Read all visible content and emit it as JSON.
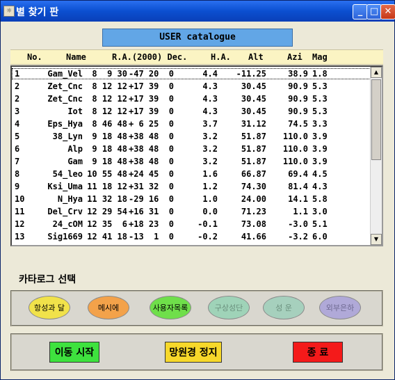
{
  "window": {
    "title": "별 찾기 판",
    "icon": "app-icon",
    "buttons": {
      "minimize": "_",
      "maximize": "□",
      "close": "✕"
    }
  },
  "catalog_title": "USER catalogue",
  "table": {
    "columns": [
      "No.",
      "Name",
      "R.A.(2000) Dec.",
      "H.A.",
      "Alt",
      "Azi",
      "Mag"
    ],
    "rows": [
      {
        "no": "1",
        "name": "Gam_Vel",
        "ra": "8  9 30",
        "dec": "-47 20  0",
        "ha": "4.4",
        "alt": "-11.25",
        "azi": "38.9",
        "mag": "1.8"
      },
      {
        "no": "2",
        "name": "Zet_Cnc",
        "ra": "8 12 12",
        "dec": "+17 39  0",
        "ha": "4.3",
        "alt": "30.45",
        "azi": "90.9",
        "mag": "5.3"
      },
      {
        "no": "2",
        "name": "Zet_Cnc",
        "ra": "8 12 12",
        "dec": "+17 39  0",
        "ha": "4.3",
        "alt": "30.45",
        "azi": "90.9",
        "mag": "5.3"
      },
      {
        "no": "3",
        "name": "Iot",
        "ra": "8 12 12",
        "dec": "+17 39  0",
        "ha": "4.3",
        "alt": "30.45",
        "azi": "90.9",
        "mag": "5.3"
      },
      {
        "no": "4",
        "name": "Eps_Hya",
        "ra": "8 46 48",
        "dec": "+ 6 25  0",
        "ha": "3.7",
        "alt": "31.12",
        "azi": "74.5",
        "mag": "3.3"
      },
      {
        "no": "5",
        "name": "38_Lyn",
        "ra": "9 18 48",
        "dec": "+38 48  0",
        "ha": "3.2",
        "alt": "51.87",
        "azi": "110.0",
        "mag": "3.9"
      },
      {
        "no": "6",
        "name": "Alp",
        "ra": "9 18 48",
        "dec": "+38 48  0",
        "ha": "3.2",
        "alt": "51.87",
        "azi": "110.0",
        "mag": "3.9"
      },
      {
        "no": "7",
        "name": "Gam",
        "ra": "9 18 48",
        "dec": "+38 48  0",
        "ha": "3.2",
        "alt": "51.87",
        "azi": "110.0",
        "mag": "3.9"
      },
      {
        "no": "8",
        "name": "54_leo",
        "ra": "10 55 48",
        "dec": "+24 45  0",
        "ha": "1.6",
        "alt": "66.87",
        "azi": "69.4",
        "mag": "4.5"
      },
      {
        "no": "9",
        "name": "Ksi_Uma",
        "ra": "11 18 12",
        "dec": "+31 32  0",
        "ha": "1.2",
        "alt": "74.30",
        "azi": "81.4",
        "mag": "4.3"
      },
      {
        "no": "10",
        "name": "N_Hya",
        "ra": "11 32 18",
        "dec": "-29 16  0",
        "ha": "1.0",
        "alt": "24.00",
        "azi": "14.1",
        "mag": "5.8"
      },
      {
        "no": "11",
        "name": "Del_Crv",
        "ra": "12 29 54",
        "dec": "+16 31  0",
        "ha": "0.0",
        "alt": "71.23",
        "azi": "1.1",
        "mag": "3.0"
      },
      {
        "no": "12",
        "name": "24_cOM",
        "ra": "12 35  6",
        "dec": "+18 23  0",
        "ha": "-0.1",
        "alt": "73.08",
        "azi": "-3.0",
        "mag": "5.1"
      },
      {
        "no": "13",
        "name": "Sig1669",
        "ra": "12 41 18",
        "dec": "-13  1  0",
        "ha": "-0.2",
        "alt": "41.66",
        "azi": "-3.2",
        "mag": "6.0"
      }
    ]
  },
  "catalog_select": {
    "label": "카타로그 선택",
    "buttons": [
      {
        "label": "항성과 달",
        "color": "#f1e24a",
        "text_color": "#000000"
      },
      {
        "label": "메시에",
        "color": "#f3a24a",
        "text_color": "#000000"
      },
      {
        "label": "사용자목록",
        "color": "#6fdf4a",
        "text_color": "#000000"
      },
      {
        "label": "구상성단",
        "color": "#9fd3b8",
        "text_color": "#6a8f7d"
      },
      {
        "label": "성 운",
        "color": "#a6d0bd",
        "text_color": "#6a8f7d"
      },
      {
        "label": "외부은하",
        "color": "#b0a9d8",
        "text_color": "#6f6a92"
      }
    ]
  },
  "actions": {
    "start": {
      "label": "이동 시작",
      "color": "#3ee23e"
    },
    "stop": {
      "label": "망원경 정지",
      "color": "#f7d82a"
    },
    "exit": {
      "label": "종 료",
      "color": "#f41a1a"
    }
  }
}
